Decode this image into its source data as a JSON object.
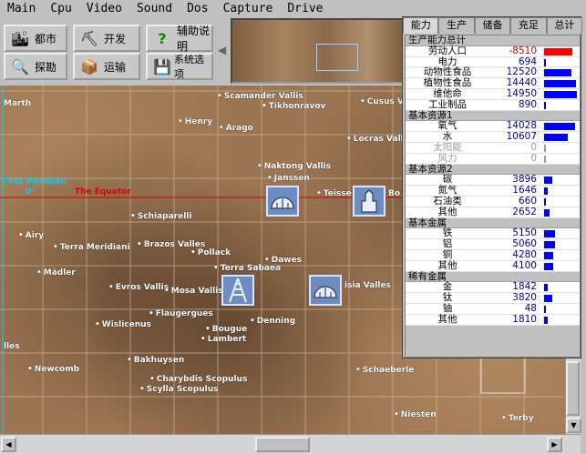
{
  "menu": [
    "Main",
    "Cpu",
    "Video",
    "Sound",
    "Dos",
    "Capture",
    "Drive"
  ],
  "toolbar": {
    "city": "都市",
    "develop": "开发",
    "help": "辅助说明",
    "explore": "探勘",
    "transport": "运输",
    "options": "系统选项"
  },
  "panel": {
    "tabs": [
      "能力",
      "生产",
      "储备",
      "充足",
      "总计"
    ],
    "sections": [
      {
        "title": "生产能力总计",
        "items": [
          {
            "label": "劳动人口",
            "value": "-8510",
            "frac": 0.85,
            "neg": true
          },
          {
            "label": "电力",
            "value": "694",
            "frac": 0.05
          },
          {
            "label": "动物性食品",
            "value": "12520",
            "frac": 0.83
          },
          {
            "label": "植物性食品",
            "value": "14440",
            "frac": 0.96
          },
          {
            "label": "维他命",
            "value": "14950",
            "frac": 1.0
          },
          {
            "label": "工业制品",
            "value": "890",
            "frac": 0.06
          }
        ]
      },
      {
        "title": "基本资源1",
        "items": [
          {
            "label": "氧气",
            "value": "14028",
            "frac": 0.94
          },
          {
            "label": "水",
            "value": "10607",
            "frac": 0.71
          },
          {
            "label": "太阳能",
            "value": "0",
            "frac": 0,
            "dim": true
          },
          {
            "label": "风力",
            "value": "0",
            "frac": 0,
            "dim": true
          }
        ]
      },
      {
        "title": "基本资源2",
        "items": [
          {
            "label": "碳",
            "value": "3896",
            "frac": 0.26
          },
          {
            "label": "氮气",
            "value": "1646",
            "frac": 0.11
          },
          {
            "label": "石油类",
            "value": "660",
            "frac": 0.04
          },
          {
            "label": "其他",
            "value": "2652",
            "frac": 0.18
          }
        ]
      },
      {
        "title": "基本金属",
        "items": [
          {
            "label": "铁",
            "value": "5150",
            "frac": 0.34
          },
          {
            "label": "铝",
            "value": "5060",
            "frac": 0.34
          },
          {
            "label": "铜",
            "value": "4280",
            "frac": 0.29
          },
          {
            "label": "其他",
            "value": "4100",
            "frac": 0.27
          }
        ]
      },
      {
        "title": "稀有金属",
        "items": [
          {
            "label": "金",
            "value": "1842",
            "frac": 0.12
          },
          {
            "label": "钛",
            "value": "3820",
            "frac": 0.26
          },
          {
            "label": "铀",
            "value": "48",
            "frac": 0.0
          },
          {
            "label": "其他",
            "value": "1810",
            "frac": 0.12
          }
        ]
      }
    ]
  },
  "map": {
    "first_meridian": "First Meridian",
    "zero_deg": "0°",
    "equator": "The Equator",
    "places": [
      {
        "id": "scamander-vallis",
        "name": "Scamander Vallis"
      },
      {
        "id": "cusus-v",
        "name": "Cusus V"
      },
      {
        "id": "tikhonravov",
        "name": "Tikhonravov"
      },
      {
        "id": "marth",
        "name": "Marth"
      },
      {
        "id": "henry",
        "name": "Henry"
      },
      {
        "id": "arago",
        "name": "Arago"
      },
      {
        "id": "locras-valle",
        "name": "Locras Valle"
      },
      {
        "id": "naktong-vallis",
        "name": "Naktong Vallis"
      },
      {
        "id": "janssen",
        "name": "Janssen"
      },
      {
        "id": "teisse",
        "name": "Teisse"
      },
      {
        "id": "bo",
        "name": "Bo"
      },
      {
        "id": "schiaparelli",
        "name": "Schiaparelli"
      },
      {
        "id": "airy",
        "name": "Airy"
      },
      {
        "id": "terra-meridiani",
        "name": "Terra Meridiani"
      },
      {
        "id": "brazos-valles",
        "name": "Brazos Valles"
      },
      {
        "id": "pollack",
        "name": "Pollack"
      },
      {
        "id": "dawes",
        "name": "Dawes"
      },
      {
        "id": "terra-sabaea",
        "name": "Terra Sabaea"
      },
      {
        "id": "madler",
        "name": "Mädler"
      },
      {
        "id": "evros-vallis",
        "name": "Evros Vallis"
      },
      {
        "id": "mosa-vallis",
        "name": "Mosa Vallis"
      },
      {
        "id": "isia-valles",
        "name": "isia Valles"
      },
      {
        "id": "flaugergues",
        "name": "Flaugergues"
      },
      {
        "id": "wislicenus",
        "name": "Wislicenus"
      },
      {
        "id": "denning",
        "name": "Denning"
      },
      {
        "id": "bougue",
        "name": "Bougue"
      },
      {
        "id": "lambert",
        "name": "Lambert"
      },
      {
        "id": "lles",
        "name": "lles"
      },
      {
        "id": "bakhuysen",
        "name": "Bakhuysen"
      },
      {
        "id": "newcomb",
        "name": "Newcomb"
      },
      {
        "id": "charybdis-scopulus",
        "name": "Charybdis Scopulus"
      },
      {
        "id": "scylla-scopulus",
        "name": "Scylla Scopulus"
      },
      {
        "id": "schaeberle",
        "name": "Schaeberle"
      },
      {
        "id": "niesten",
        "name": "Niesten"
      },
      {
        "id": "terby",
        "name": "Terby"
      }
    ]
  }
}
